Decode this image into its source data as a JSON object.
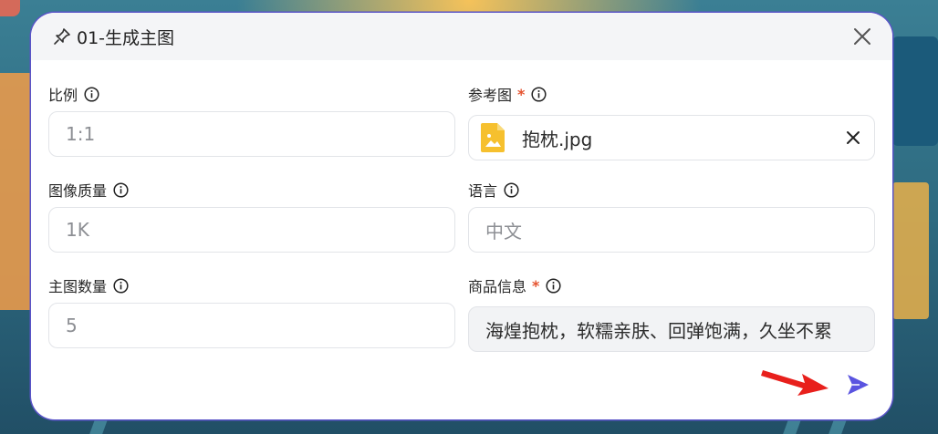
{
  "dialog": {
    "title": "01-生成主图",
    "icons": {
      "title": "sparkle-pin-icon",
      "close": "close-icon",
      "send": "send-icon"
    }
  },
  "fields": {
    "ratio": {
      "label": "比例",
      "placeholder": "1:1"
    },
    "reference": {
      "label": "参考图",
      "required_mark": "*",
      "file_name": "抱枕.jpg"
    },
    "quality": {
      "label": "图像质量",
      "placeholder": "1K"
    },
    "language": {
      "label": "语言",
      "placeholder": "中文"
    },
    "count": {
      "label": "主图数量",
      "placeholder": "5"
    },
    "product_info": {
      "label": "商品信息",
      "required_mark": "*",
      "value": "海煌抱枕，软糯亲肤、回弹饱满，久坐不累"
    }
  },
  "colors": {
    "accent": "#5a54c8",
    "required": "#e5532f",
    "annotation_arrow": "#e8201c"
  }
}
